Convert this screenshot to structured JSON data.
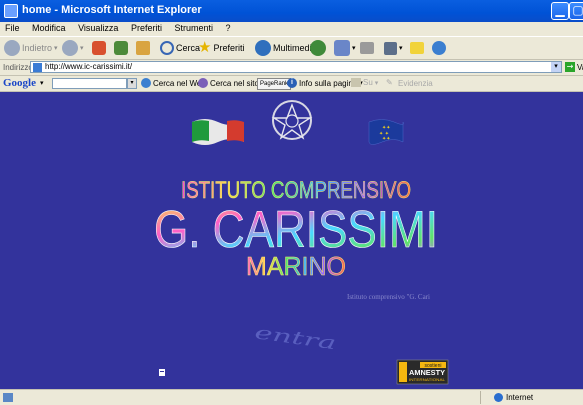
{
  "window": {
    "title": "home - Microsoft Internet Explorer",
    "controls": [
      "minimize",
      "maximize"
    ]
  },
  "menubar": {
    "items": [
      "File",
      "Modifica",
      "Visualizza",
      "Preferiti",
      "Strumenti",
      "?"
    ]
  },
  "toolbar": {
    "back_label": "Indietro",
    "search_label": "Cerca",
    "favorites_label": "Preferiti",
    "multimedia_label": "Multimedia"
  },
  "address": {
    "label": "Indirizzo",
    "url": "http://www.ic-carissimi.it/",
    "go_label": "Va"
  },
  "googlebar": {
    "logo": "Google",
    "search_web": "Cerca nel Web",
    "search_site": "Cerca nel sito",
    "pagerank": "PageRank",
    "info": "Info sulla pagina",
    "up": "Su",
    "highlight": "Evidenzia"
  },
  "page": {
    "heading_1": "ISTITUTO COMPRENSIVO",
    "heading_2": "G. CARISSIMI",
    "heading_3": "MARINO",
    "marquee_text": "Istituto comprensivo \"G. Cari",
    "enter_label": "entra",
    "badge_small": "sostieni",
    "badge_label": "AMNESTY",
    "badge_sub": "INTERNATIONAL"
  },
  "status": {
    "zone": "Internet"
  }
}
